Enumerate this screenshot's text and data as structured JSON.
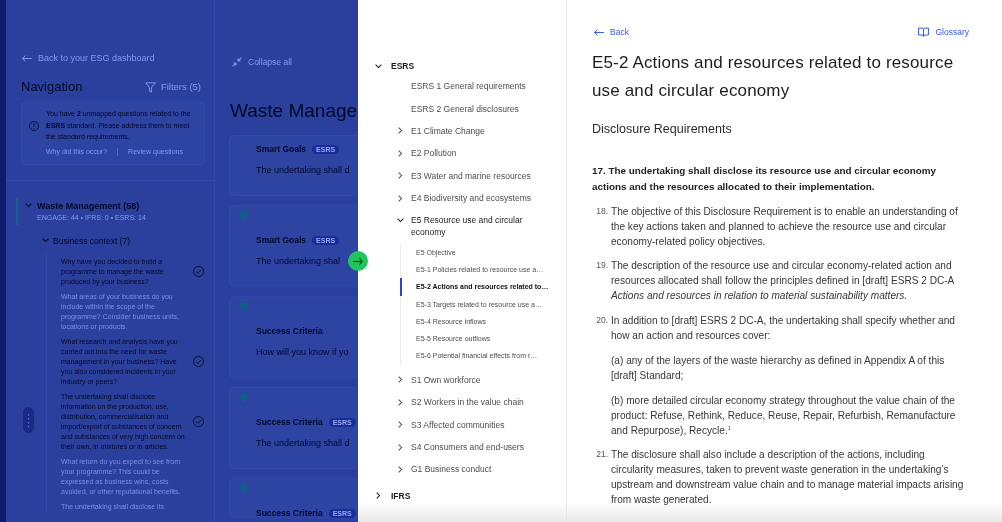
{
  "background_app": {
    "back_link": "Back to your ESG dashboard",
    "navigation": {
      "title": "Navigation",
      "filters": "Filters (5)",
      "notice": {
        "text": "You have **2** unmapped questions related to the **ESRS** standard. Please address them to meet the standard requirements.",
        "links": [
          "Why did this occur?",
          "Review questions"
        ]
      },
      "section": {
        "title": "Waste Management (58)",
        "counts": "ENGAGE: 44 • IFRS: 0 • ESRS: 14",
        "selected": true,
        "expanded": true,
        "groups": [
          {
            "title": "Business context (7)",
            "expanded": true,
            "questions": [
              {
                "text": "Why have you decided to build a programme to manage the waste produced by your business?",
                "answered": true
              },
              {
                "text": "What areas of your business do you include within the scope of the programme? Consider business units, locations or products.",
                "answered": false
              },
              {
                "text": "What research and analysis have you carried out into the need for waste management in your business? Have you also considered incidents in your industry or peers?",
                "answered": true
              },
              {
                "text": "The undertaking shall disclose information on the production, use, distribution, commercialisation and import/export of substances of concern and substances of very high concern on their own, in mixtures or in articles.",
                "answered": true
              },
              {
                "text": "What return do you expect to see from your programme? This could be expressed as business wins, costs avoided, or other reputational benefits.",
                "answered": false
              },
              {
                "text": "The undertaking shall disclose its",
                "answered": false
              }
            ]
          }
        ]
      }
    },
    "collapse_all": "Collapse all",
    "page_title": "Waste Manage",
    "cards": [
      {
        "title": "Smart Goals",
        "badge": "ESRS",
        "text": "The undertaking shall d",
        "timeline_dot": false
      },
      {
        "title": "Smart Goals",
        "badge": "ESRS",
        "text": "The undertaking shal",
        "timeline_dot": true
      },
      {
        "title": "Success Criteria",
        "text": "How will you know if yo",
        "timeline_dot": true
      },
      {
        "title": "Success Criteria",
        "badge": "ESRS",
        "text": "The undertaking shall d",
        "timeline_dot": true
      },
      {
        "title": "Success Criteria",
        "badge": "ESRS",
        "timeline_dot": true
      }
    ]
  },
  "drawer": {
    "tree": [
      {
        "label": "ESRS",
        "kind": "group",
        "expanded": true,
        "selected": false,
        "children": [
          {
            "label": "ESRS 1 General requirements",
            "kind": "leaf",
            "selected": false
          },
          {
            "label": "ESRS 2 General disclosures",
            "kind": "leaf",
            "selected": false
          },
          {
            "label": "E1 Climate Change",
            "kind": "group",
            "expanded": false,
            "selected": false
          },
          {
            "label": "E2 Pollution",
            "kind": "group",
            "expanded": false,
            "selected": false
          },
          {
            "label": "E3 Water and marine resources",
            "kind": "group",
            "expanded": false,
            "selected": false
          },
          {
            "label": "E4 Biodiversity and ecosystems",
            "kind": "group",
            "expanded": false,
            "selected": false
          },
          {
            "label": "E5 Resource use and circular economy",
            "kind": "group",
            "expanded": true,
            "selected": false,
            "children": [
              {
                "label": "E5 Objective",
                "selected": false
              },
              {
                "label": "E5-1 Policies related to resource use a…",
                "selected": false
              },
              {
                "label": "E5-2 Actions and resources related to…",
                "selected": true
              },
              {
                "label": "E5-3 Targets related to resource use a…",
                "selected": false
              },
              {
                "label": "E5-4 Resource inflows",
                "selected": false
              },
              {
                "label": "E5-5 Resource outflows",
                "selected": false
              },
              {
                "label": "E5-6 Potential financial effects from r…",
                "selected": false
              }
            ]
          },
          {
            "label": "S1 Own workforce",
            "kind": "group",
            "expanded": false,
            "selected": false
          },
          {
            "label": "S2 Workers in the value chain",
            "kind": "group",
            "expanded": false,
            "selected": false
          },
          {
            "label": "S3 Affected communities",
            "kind": "group",
            "expanded": false,
            "selected": false
          },
          {
            "label": "S4 Consumers and end-users",
            "kind": "group",
            "expanded": false,
            "selected": false
          },
          {
            "label": "G1 Business conduct",
            "kind": "group",
            "expanded": false,
            "selected": false
          }
        ]
      },
      {
        "label": "IFRS",
        "kind": "group",
        "expanded": false,
        "selected": false
      }
    ],
    "back": "Back",
    "glossary": "Glossary",
    "title": "E5-2 Actions and resources related to resource use and circular economy",
    "subtitle": "Disclosure Requirements",
    "lead": "17. The undertaking shall disclose its resource use and circular economy actions and the resources allocated to their implementation.",
    "paragraphs": [
      {
        "number": "18.",
        "text": "The objective of this Disclosure Requirement is to enable an understanding of the key actions taken and planned to achieve the resource use and circular economy-related policy objectives."
      },
      {
        "number": "19.",
        "text": "The description of the resource use and circular economy-related action and resources allocated shall follow the principles defined in [draft] ESRS 2 DC-A *Actions and resources in relation to material sustainability matters.*"
      },
      {
        "number": "20.",
        "text": "In addition to [draft] ESRS 2 DC-A, the undertaking shall specify whether and how an action and resources cover:",
        "subparagraphs": [
          "(a) any of the layers of the waste hierarchy as defined in Appendix A of this [draft] Standard;",
          "(b) more detailed circular economy strategy throughout the value chain of the product: Refuse, Rethink, Reduce, Reuse, Repair, Refurbish, Remanufacture and Repurpose), Recycle.$^{1}$"
        ]
      },
      {
        "number": "21.",
        "text": "The disclosure shall also include a description of the actions, including circularity measures, taken to prevent waste generation in the undertaking’s upstream and downstream value chain and to manage material impacts arising from waste generated."
      }
    ]
  }
}
